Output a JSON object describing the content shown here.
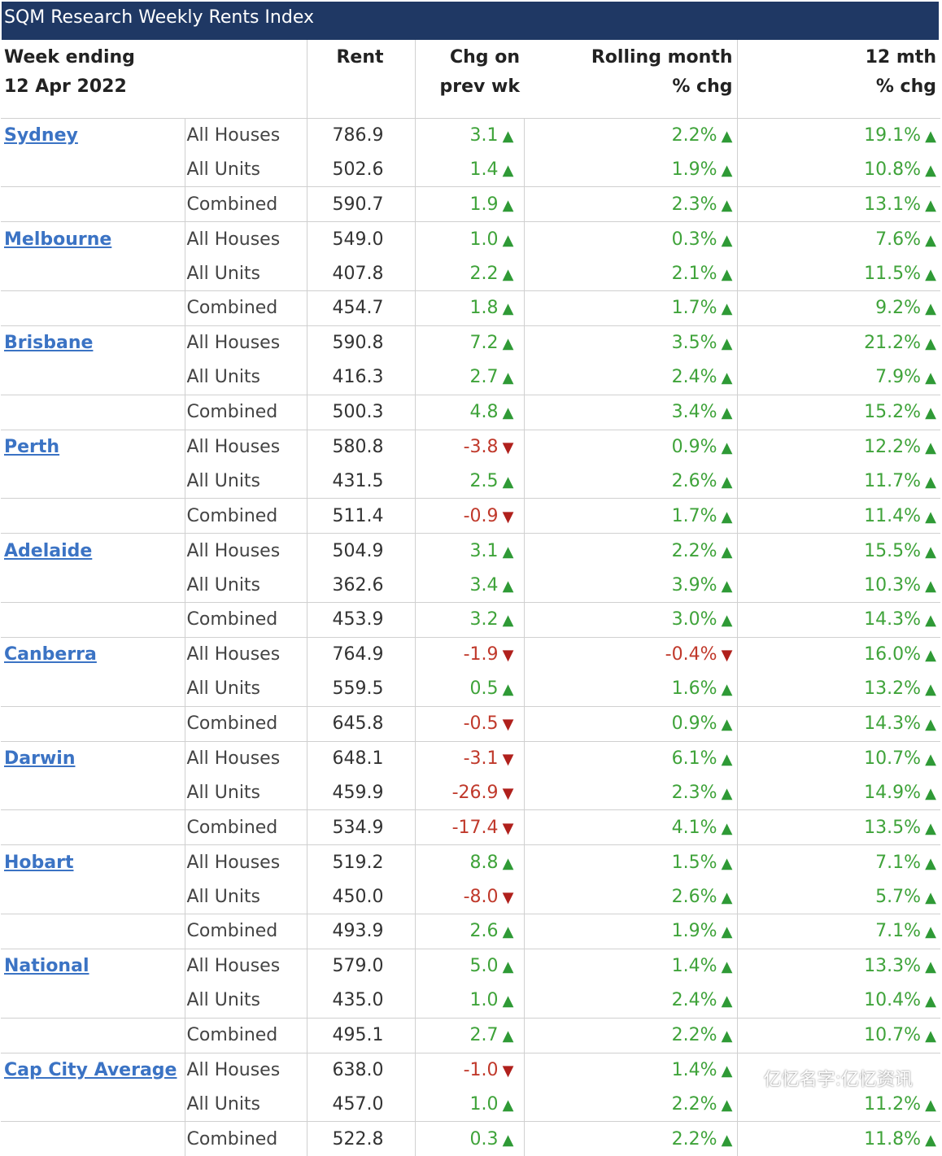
{
  "title": "SQM Research Weekly Rents Index",
  "header": {
    "week_ending_label": "Week ending",
    "week_date": "12 Apr 2022",
    "rent": "Rent",
    "chg_line1": "Chg on",
    "chg_line2": "prev wk",
    "roll_line1": "Rolling month",
    "roll_line2": "% chg",
    "yr_line1": "12 mth",
    "yr_line2": "% chg"
  },
  "rows": [
    {
      "city": "Sydney",
      "type": "All Houses",
      "rent": "786.9",
      "chg": "3.1",
      "chg_dir": "up",
      "roll": "2.2%",
      "roll_dir": "up",
      "yr": "19.1%",
      "yr_dir": "up"
    },
    {
      "city": "",
      "type": "All Units",
      "rent": "502.6",
      "chg": "1.4",
      "chg_dir": "up",
      "roll": "1.9%",
      "roll_dir": "up",
      "yr": "10.8%",
      "yr_dir": "up"
    },
    {
      "city": "",
      "type": "Combined",
      "rent": "590.7",
      "chg": "1.9",
      "chg_dir": "up",
      "roll": "2.3%",
      "roll_dir": "up",
      "yr": "13.1%",
      "yr_dir": "up"
    },
    {
      "city": "Melbourne",
      "type": "All Houses",
      "rent": "549.0",
      "chg": "1.0",
      "chg_dir": "up",
      "roll": "0.3%",
      "roll_dir": "up",
      "yr": "7.6%",
      "yr_dir": "up"
    },
    {
      "city": "",
      "type": "All Units",
      "rent": "407.8",
      "chg": "2.2",
      "chg_dir": "up",
      "roll": "2.1%",
      "roll_dir": "up",
      "yr": "11.5%",
      "yr_dir": "up"
    },
    {
      "city": "",
      "type": "Combined",
      "rent": "454.7",
      "chg": "1.8",
      "chg_dir": "up",
      "roll": "1.7%",
      "roll_dir": "up",
      "yr": "9.2%",
      "yr_dir": "up"
    },
    {
      "city": "Brisbane",
      "type": "All Houses",
      "rent": "590.8",
      "chg": "7.2",
      "chg_dir": "up",
      "roll": "3.5%",
      "roll_dir": "up",
      "yr": "21.2%",
      "yr_dir": "up"
    },
    {
      "city": "",
      "type": "All Units",
      "rent": "416.3",
      "chg": "2.7",
      "chg_dir": "up",
      "roll": "2.4%",
      "roll_dir": "up",
      "yr": "7.9%",
      "yr_dir": "up"
    },
    {
      "city": "",
      "type": "Combined",
      "rent": "500.3",
      "chg": "4.8",
      "chg_dir": "up",
      "roll": "3.4%",
      "roll_dir": "up",
      "yr": "15.2%",
      "yr_dir": "up"
    },
    {
      "city": "Perth",
      "type": "All Houses",
      "rent": "580.8",
      "chg": "-3.8",
      "chg_dir": "down",
      "roll": "0.9%",
      "roll_dir": "up",
      "yr": "12.2%",
      "yr_dir": "up"
    },
    {
      "city": "",
      "type": "All Units",
      "rent": "431.5",
      "chg": "2.5",
      "chg_dir": "up",
      "roll": "2.6%",
      "roll_dir": "up",
      "yr": "11.7%",
      "yr_dir": "up"
    },
    {
      "city": "",
      "type": "Combined",
      "rent": "511.4",
      "chg": "-0.9",
      "chg_dir": "down",
      "roll": "1.7%",
      "roll_dir": "up",
      "yr": "11.4%",
      "yr_dir": "up"
    },
    {
      "city": "Adelaide",
      "type": "All Houses",
      "rent": "504.9",
      "chg": "3.1",
      "chg_dir": "up",
      "roll": "2.2%",
      "roll_dir": "up",
      "yr": "15.5%",
      "yr_dir": "up"
    },
    {
      "city": "",
      "type": "All Units",
      "rent": "362.6",
      "chg": "3.4",
      "chg_dir": "up",
      "roll": "3.9%",
      "roll_dir": "up",
      "yr": "10.3%",
      "yr_dir": "up"
    },
    {
      "city": "",
      "type": "Combined",
      "rent": "453.9",
      "chg": "3.2",
      "chg_dir": "up",
      "roll": "3.0%",
      "roll_dir": "up",
      "yr": "14.3%",
      "yr_dir": "up"
    },
    {
      "city": "Canberra",
      "type": "All Houses",
      "rent": "764.9",
      "chg": "-1.9",
      "chg_dir": "down",
      "roll": "-0.4%",
      "roll_dir": "down",
      "yr": "16.0%",
      "yr_dir": "up"
    },
    {
      "city": "",
      "type": "All Units",
      "rent": "559.5",
      "chg": "0.5",
      "chg_dir": "up",
      "roll": "1.6%",
      "roll_dir": "up",
      "yr": "13.2%",
      "yr_dir": "up"
    },
    {
      "city": "",
      "type": "Combined",
      "rent": "645.8",
      "chg": "-0.5",
      "chg_dir": "down",
      "roll": "0.9%",
      "roll_dir": "up",
      "yr": "14.3%",
      "yr_dir": "up"
    },
    {
      "city": "Darwin",
      "type": "All Houses",
      "rent": "648.1",
      "chg": "-3.1",
      "chg_dir": "down",
      "roll": "6.1%",
      "roll_dir": "up",
      "yr": "10.7%",
      "yr_dir": "up"
    },
    {
      "city": "",
      "type": "All Units",
      "rent": "459.9",
      "chg": "-26.9",
      "chg_dir": "down",
      "roll": "2.3%",
      "roll_dir": "up",
      "yr": "14.9%",
      "yr_dir": "up"
    },
    {
      "city": "",
      "type": "Combined",
      "rent": "534.9",
      "chg": "-17.4",
      "chg_dir": "down",
      "roll": "4.1%",
      "roll_dir": "up",
      "yr": "13.5%",
      "yr_dir": "up"
    },
    {
      "city": "Hobart",
      "type": "All Houses",
      "rent": "519.2",
      "chg": "8.8",
      "chg_dir": "up",
      "roll": "1.5%",
      "roll_dir": "up",
      "yr": "7.1%",
      "yr_dir": "up"
    },
    {
      "city": "",
      "type": "All Units",
      "rent": "450.0",
      "chg": "-8.0",
      "chg_dir": "down",
      "roll": "2.6%",
      "roll_dir": "up",
      "yr": "5.7%",
      "yr_dir": "up"
    },
    {
      "city": "",
      "type": "Combined",
      "rent": "493.9",
      "chg": "2.6",
      "chg_dir": "up",
      "roll": "1.9%",
      "roll_dir": "up",
      "yr": "7.1%",
      "yr_dir": "up"
    },
    {
      "city": "National",
      "type": "All Houses",
      "rent": "579.0",
      "chg": "5.0",
      "chg_dir": "up",
      "roll": "1.4%",
      "roll_dir": "up",
      "yr": "13.3%",
      "yr_dir": "up"
    },
    {
      "city": "",
      "type": "All Units",
      "rent": "435.0",
      "chg": "1.0",
      "chg_dir": "up",
      "roll": "2.4%",
      "roll_dir": "up",
      "yr": "10.4%",
      "yr_dir": "up"
    },
    {
      "city": "",
      "type": "Combined",
      "rent": "495.1",
      "chg": "2.7",
      "chg_dir": "up",
      "roll": "2.2%",
      "roll_dir": "up",
      "yr": "10.7%",
      "yr_dir": "up"
    },
    {
      "city": "Cap City Average",
      "type": "All Houses",
      "rent": "638.0",
      "chg": "-1.0",
      "chg_dir": "down",
      "roll": "1.4%",
      "roll_dir": "up",
      "yr": "",
      "yr_dir": "up"
    },
    {
      "city": "",
      "type": "All Units",
      "rent": "457.0",
      "chg": "1.0",
      "chg_dir": "up",
      "roll": "2.2%",
      "roll_dir": "up",
      "yr": "11.2%",
      "yr_dir": "up"
    },
    {
      "city": "",
      "type": "Combined",
      "rent": "522.8",
      "chg": "0.3",
      "chg_dir": "up",
      "roll": "2.2%",
      "roll_dir": "up",
      "yr": "11.8%",
      "yr_dir": "up"
    }
  ],
  "watermark": "亿忆名字:亿忆资讯",
  "colors": {
    "header_bg": "#1f3864",
    "positive": "#3fa33a",
    "negative": "#c0392b",
    "link": "#3b73c4"
  }
}
